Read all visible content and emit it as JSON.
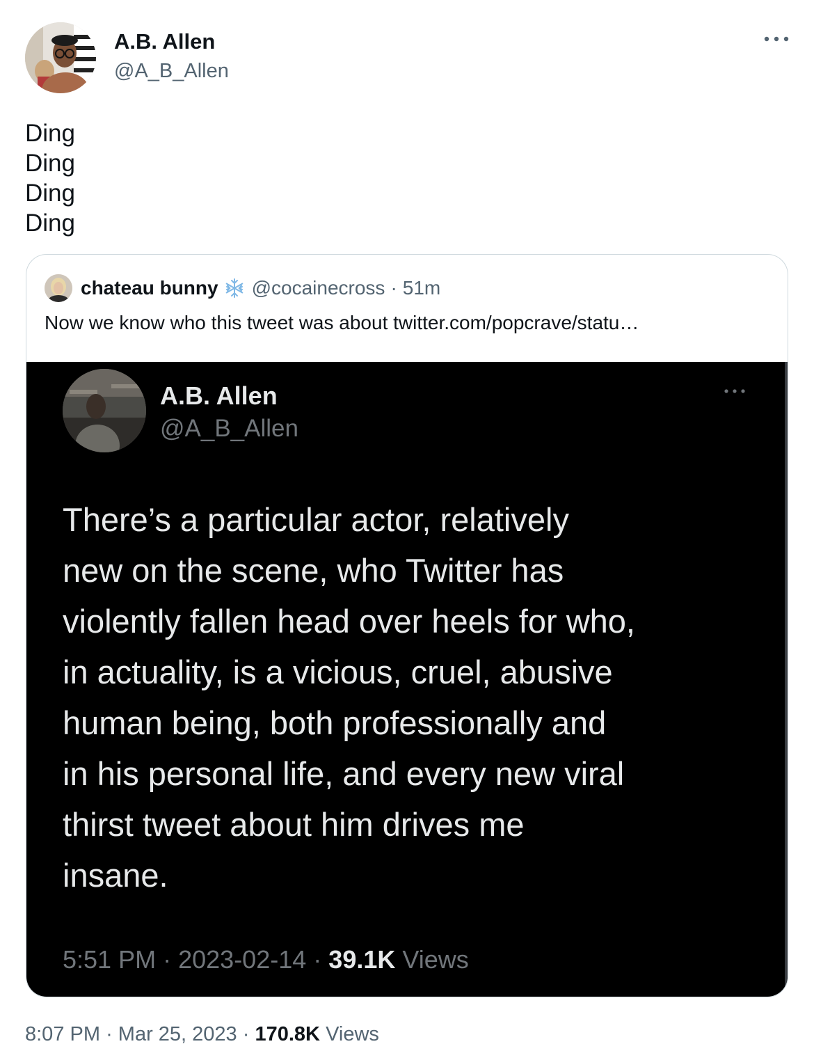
{
  "author": {
    "name": "A.B. Allen",
    "handle": "@A_B_Allen",
    "more_icon": "more-horizontal-icon"
  },
  "tweet": {
    "lines": [
      "Ding",
      "Ding",
      "Ding",
      "Ding"
    ]
  },
  "quoted": {
    "name": "chateau bunny",
    "badge_icon": "snowflake-icon",
    "handle": "@cocainecross",
    "separator": "·",
    "time": "51m",
    "text": "Now we know who this tweet was about  twitter.com/popcrave/statu…",
    "screenshot": {
      "name": "A.B. Allen",
      "handle": "@A_B_Allen",
      "lines": [
        "There’s a particular actor, relatively",
        "new on the scene, who Twitter has",
        "violently fallen head over heels for who,",
        "in actuality, is a vicious, cruel, abusive",
        "human being, both professionally and",
        "in his personal life, and every new viral",
        "thirst tweet about him drives me",
        "insane."
      ],
      "meta": {
        "time": "5:51 PM",
        "date": "2023-02-14",
        "views_count": "39.1K",
        "views_label": "Views",
        "separator": "·"
      }
    }
  },
  "footer": {
    "time": "8:07 PM",
    "date": "Mar 25, 2023",
    "views_count": "170.8K",
    "views_label": "Views",
    "separator": "·"
  },
  "colors": {
    "text_primary": "#0f1419",
    "text_secondary": "#536471",
    "border": "#cfd9de",
    "badge": "#7fb8e6",
    "dark_bg": "#000000",
    "dark_text": "#e7e9ea",
    "dark_secondary": "#71767b"
  }
}
